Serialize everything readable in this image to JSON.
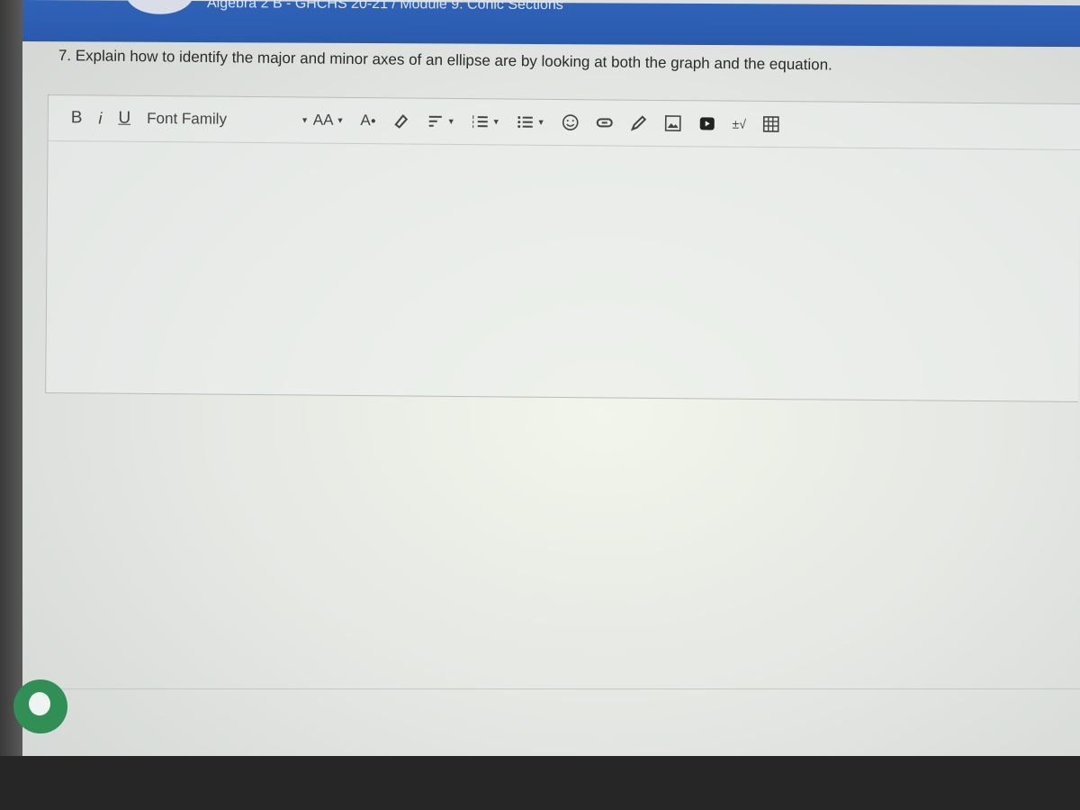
{
  "header": {
    "breadcrumb": "Algebra 2 B - GHCHS 20-21 / Module 9: Conic Sections"
  },
  "question": {
    "text": "7. Explain how to identify the major and minor axes of an ellipse are by looking at both the graph and the equation."
  },
  "toolbar": {
    "bold": "B",
    "italic": "i",
    "underline": "U",
    "font_family": "Font Family",
    "font_size": "AA",
    "font_color": "A",
    "icons": [
      "bold",
      "italic",
      "underline",
      "font-family",
      "font-size",
      "font-color",
      "highlight",
      "align",
      "ordered-list",
      "unordered-list",
      "emoji",
      "link",
      "pencil",
      "image",
      "video",
      "equation",
      "table"
    ]
  },
  "editor": {
    "value": ""
  },
  "colors": {
    "header": "#2f63b8",
    "chat": "#2f8f55"
  }
}
